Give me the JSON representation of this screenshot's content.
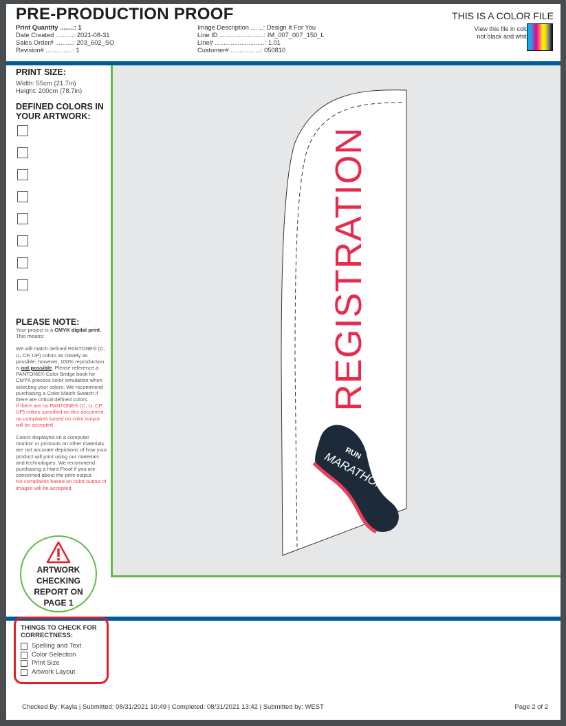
{
  "header": {
    "title": "PRE-PRODUCTION PROOF",
    "left_meta": [
      {
        "label": "Print Quantity ........:",
        "value": "1",
        "bold": true
      },
      {
        "label": "Date Created ..........:",
        "value": "2021-08-31"
      },
      {
        "label": "Sales Order# ..........:",
        "value": "203_602_SO"
      },
      {
        "label": "Revision# ...............:",
        "value": "1"
      }
    ],
    "right_meta": [
      {
        "label": "Image Description .......:",
        "value": "Design It For You"
      },
      {
        "label": "Line ID .........................:",
        "value": "IM_007_007_150_L"
      },
      {
        "label": "Line# ............................:",
        "value": "1.01"
      },
      {
        "label": "Customer# .................:",
        "value": "050810"
      }
    ],
    "color_file": {
      "heading": "THIS IS A COLOR FILE",
      "line1": "View this file in color,",
      "line2": "not black and white."
    }
  },
  "sidebar": {
    "print_size_heading": "PRINT SIZE:",
    "width": "Width:  55cm  (21.7in)",
    "height": "Height: 200cm  (78.7in)",
    "defined_colors_heading": "DEFINED COLORS IN YOUR ARTWORK:",
    "color_swatch_count": 8,
    "note": {
      "heading": "PLEASE NOTE:",
      "intro_pre": "Your project is a ",
      "intro_bold": "CMYK digital print",
      "intro_post": ". This means:",
      "p1_pre": "We will match defined PANTONE® (C, U, CP, UP) colors as closely as possible; however, 100% reproduction is ",
      "p1_bold": "not possible",
      "p1_post": ". Please reference a PANTONE® Color Bridge book for CMYK process color simulation when selecting your colors. We recommend purchasing a Color Match Swatch if there are critical defined colors.",
      "p1_red": "If there are no PANTONE® (C, U, CP, UP) colors specified on this document, no complaints based on color output will be accepted.",
      "p2": "Colors displayed on a computer monitor or printouts on other materials are not accurate depictions of how your product will print using our materials and technologies. We recommend purchasing a Hard Proof if you are concerned about the print output.",
      "p2_red": "No complaints based on color output of images will be accepted."
    },
    "badge": [
      "ARTWORK",
      "CHECKING",
      "REPORT ON",
      "PAGE 1"
    ]
  },
  "artwork": {
    "flag_text": "REGISTRATION",
    "logo_top": "RUN",
    "logo_main": "MARATHON",
    "colors": {
      "text": "#e82a4e",
      "logo_dark": "#1c2a3a",
      "logo_accent": "#ef3f5a"
    }
  },
  "checklist": {
    "heading": "THINGS TO CHECK FOR CORRECTNESS:",
    "items": [
      "Spelling and Text",
      "Color Selection",
      "Print Size",
      "Artwork Layout"
    ]
  },
  "footer": {
    "text": "Checked By: Kayla | Submitted: 08/31/2021 10:49 | Completed: 08/31/2021 13:42 | Submitted by: WEST",
    "page": "Page 2 of 2"
  }
}
